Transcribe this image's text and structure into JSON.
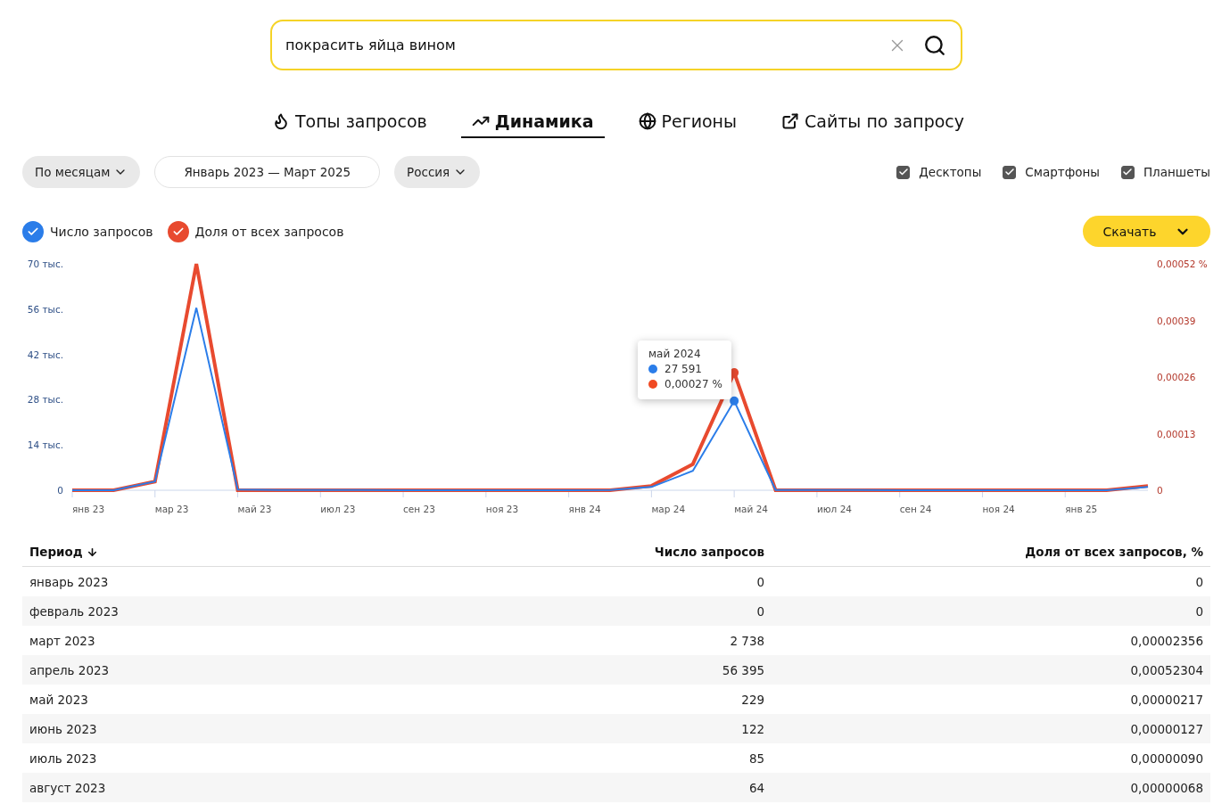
{
  "search": {
    "value": "покрасить яйца вином"
  },
  "tabs": [
    {
      "label": "Топы запросов",
      "selected": false
    },
    {
      "label": "Динамика",
      "selected": true
    },
    {
      "label": "Регионы",
      "selected": false
    },
    {
      "label": "Сайты по запросу",
      "selected": false
    }
  ],
  "filters": {
    "grouping": "По месяцам",
    "period": "Январь 2023 — Март 2025",
    "region": "Россия"
  },
  "devices": [
    {
      "label": "Десктопы",
      "checked": true
    },
    {
      "label": "Смартфоны",
      "checked": true
    },
    {
      "label": "Планшеты",
      "checked": true
    }
  ],
  "legend": [
    {
      "checked": true
    },
    {
      "checked": true
    }
  ],
  "download_button": "Скачать",
  "chart": {
    "chart_data": {
      "type": "line",
      "categories": [
        "янв 23",
        null,
        "мар 23",
        null,
        "май 23",
        null,
        "июл 23",
        null,
        "сен 23",
        null,
        "ноя 23",
        null,
        "янв 24",
        null,
        "мар 24",
        null,
        "май 24",
        null,
        "июл 24",
        null,
        "сен 24",
        null,
        "ноя 24",
        null,
        "янв 25",
        null,
        null
      ],
      "ylim": [
        0,
        70
      ],
      "yticks": [
        {
          "value": 0,
          "label": "0"
        },
        {
          "value": 14,
          "label": "14 тыс."
        },
        {
          "value": 28,
          "label": "28 тыс."
        },
        {
          "value": 42,
          "label": "42 тыс."
        },
        {
          "value": 56,
          "label": "56 тыс."
        },
        {
          "value": 70,
          "label": "70 тыс."
        }
      ],
      "y2lim": [
        0,
        0.00052
      ],
      "y2ticks": [
        {
          "value": 0,
          "label": "0"
        },
        {
          "value": 0.00013,
          "label": "0,00013"
        },
        {
          "value": 0.00026,
          "label": "0,00026"
        },
        {
          "value": 0.00039,
          "label": "0,00039"
        },
        {
          "value": 0.00052,
          "label": "0,00052 %"
        }
      ],
      "series": [
        {
          "name": "Число запросов",
          "color": "#2b7de9",
          "values": [
            0,
            0,
            2.7,
            56.4,
            0.2,
            0.1,
            0.1,
            0.1,
            0,
            0,
            0,
            0,
            0,
            0.1,
            1,
            6,
            27.6,
            0.1,
            0.1,
            0.1,
            0,
            0,
            0,
            0,
            0,
            0,
            1
          ]
        },
        {
          "name": "Доля от всех запросов",
          "color": "#e84a2f",
          "axis": "y2",
          "values": [
            0,
            0,
            2e-05,
            0.00052,
            0,
            0,
            0,
            0,
            0,
            0,
            0,
            0,
            0,
            0,
            1e-05,
            6e-05,
            0.00027,
            0,
            0,
            0,
            0,
            0,
            0,
            0,
            0,
            0,
            1e-05
          ]
        }
      ]
    },
    "tooltip": {
      "title": "май 2024",
      "items": [
        {
          "text": "27 591",
          "color": "#2b7de9"
        },
        {
          "text": "0,00027 %",
          "color": "#f04a23"
        }
      ]
    }
  },
  "table": {
    "columns": [
      "Период",
      "Число запросов",
      "Доля от всех запросов, %"
    ],
    "rows": [
      [
        "январь 2023",
        "0",
        "0"
      ],
      [
        "февраль 2023",
        "0",
        "0"
      ],
      [
        "март 2023",
        "2 738",
        "0,00002356"
      ],
      [
        "апрель 2023",
        "56 395",
        "0,00052304"
      ],
      [
        "май 2023",
        "229",
        "0,00000217"
      ],
      [
        "июнь 2023",
        "122",
        "0,00000127"
      ],
      [
        "июль 2023",
        "85",
        "0,00000090"
      ],
      [
        "август 2023",
        "64",
        "0,00000068"
      ]
    ]
  }
}
